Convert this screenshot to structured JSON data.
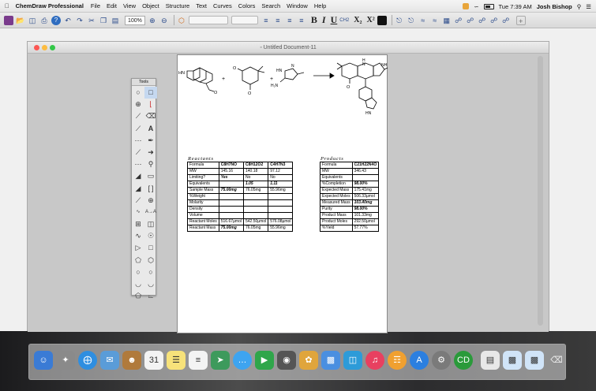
{
  "menubar": {
    "app_name": "ChemDraw Professional",
    "items": [
      "File",
      "Edit",
      "View",
      "Object",
      "Structure",
      "Text",
      "Curves",
      "Colors",
      "Search",
      "Window",
      "Help"
    ],
    "clock": "Tue 7:39 AM",
    "user": "Josh Bishop"
  },
  "toolbar": {
    "zoom": "100%"
  },
  "window": {
    "title": "Untitled Document-11"
  },
  "palette": {
    "title": "Tools"
  },
  "document": {
    "reactants_header": "Reactants",
    "products_header": "Products",
    "reactants_table": [
      [
        "Formula",
        "C8H7NO",
        "C8H12O2",
        "C4H7N3"
      ],
      [
        "MW",
        "145.16",
        "140.18",
        "97.12"
      ],
      [
        "Limiting?",
        "Yes",
        "No",
        "No"
      ],
      [
        "Equivalents",
        "",
        "1.05",
        "1.11"
      ],
      [
        "Sample Mass",
        "75.00mg",
        "76.05mg",
        "55.96mg"
      ],
      [
        "%Weight",
        "",
        "",
        ""
      ],
      [
        "Molarity",
        "",
        "",
        ""
      ],
      [
        "Density",
        "",
        "",
        ""
      ],
      [
        "Volume",
        "",
        "",
        ""
      ],
      [
        "Reactant Moles",
        "516.67µmol",
        "542.50µmol",
        "576.08µmol"
      ],
      [
        "Reactant Mass",
        "75.00mg",
        "76.05mg",
        "55.96mg"
      ]
    ],
    "products_table": [
      [
        "Formula",
        "C21H22N4O"
      ],
      [
        "MW",
        "346.43"
      ],
      [
        "Equivalents",
        ""
      ],
      [
        "%Completion",
        "98.00%"
      ],
      [
        "Expected Mass",
        "175.41mg"
      ],
      [
        "Expected Moles",
        "506.33µmol"
      ],
      [
        "Measured Mass",
        "103.40mg"
      ],
      [
        "Purity",
        "98.00%"
      ],
      [
        "Product Mass",
        "101.33mg"
      ],
      [
        "Product Moles",
        "292.50µmol"
      ],
      [
        "%Yield",
        "57.77%"
      ]
    ]
  },
  "colors": {
    "canvas": "#c8c8c8",
    "close": "#fc5753",
    "minimize": "#fdbc40",
    "zoom": "#33c748"
  }
}
